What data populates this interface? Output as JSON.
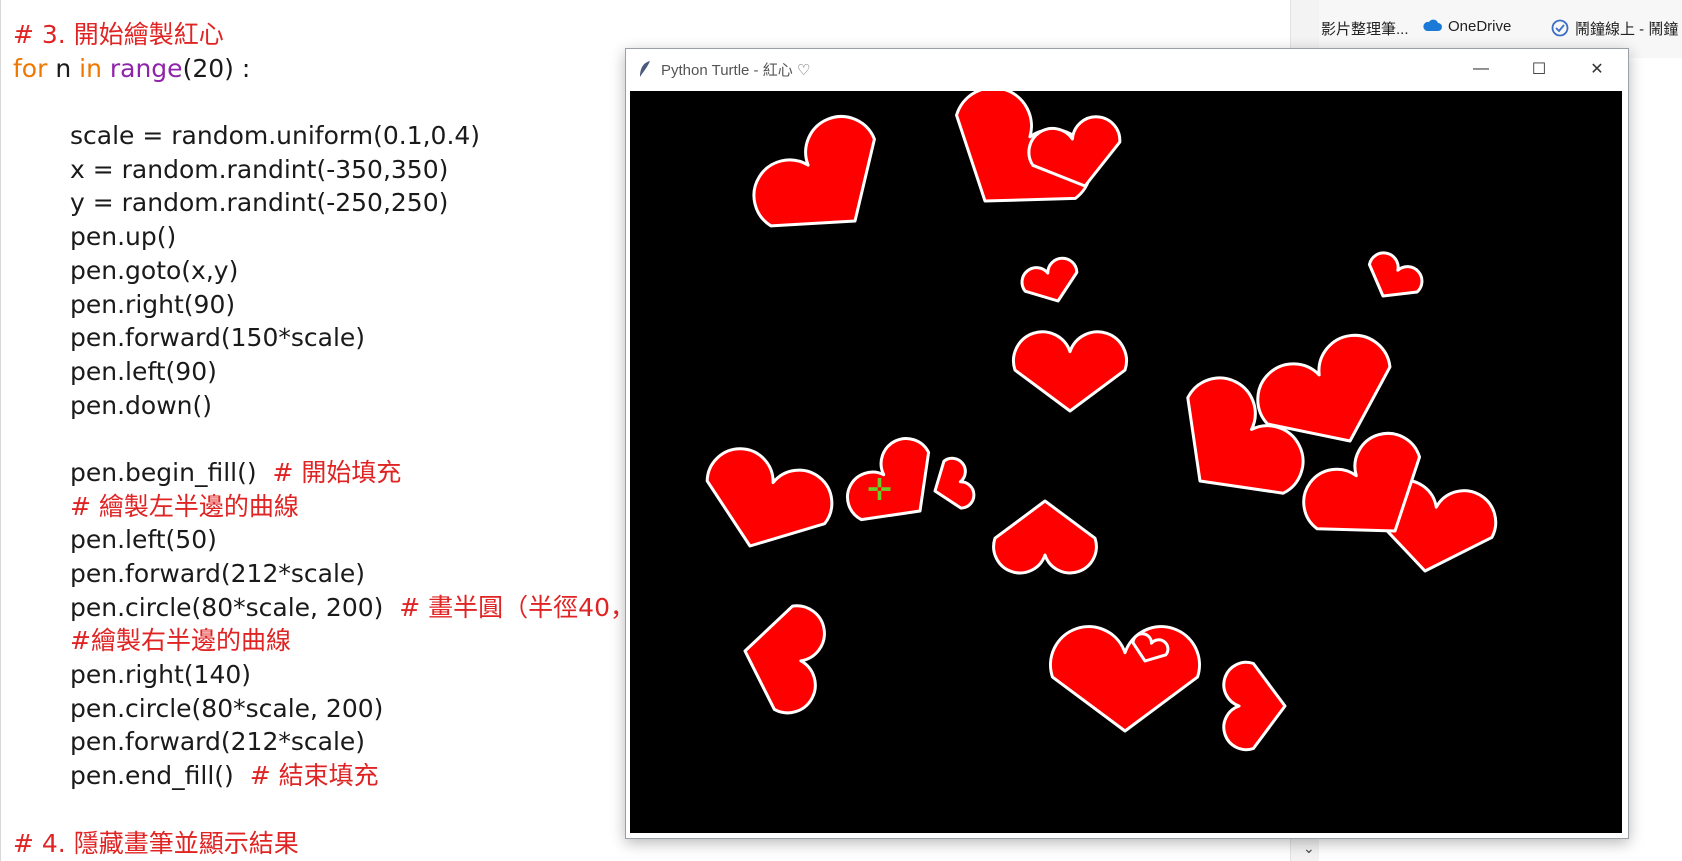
{
  "code": {
    "lines": [
      {
        "type": "comment",
        "text": "# 3. 開始繪製紅心"
      },
      {
        "type": "for",
        "kw1": "for",
        "var": " n ",
        "kw2": "in",
        "fn": " range",
        "rest": "(20) :"
      },
      {
        "type": "blank"
      },
      {
        "type": "code",
        "text": "scale = random.uniform(0.1,0.4)"
      },
      {
        "type": "code",
        "text": "x = random.randint(-350,350)"
      },
      {
        "type": "code",
        "text": "y = random.randint(-250,250)"
      },
      {
        "type": "code",
        "text": "pen.up()"
      },
      {
        "type": "code",
        "text": "pen.goto(x,y)"
      },
      {
        "type": "code",
        "text": "pen.right(90)"
      },
      {
        "type": "code",
        "text": "pen.forward(150*scale)"
      },
      {
        "type": "code",
        "text": "pen.left(90)"
      },
      {
        "type": "code",
        "text": "pen.down()"
      },
      {
        "type": "blank"
      },
      {
        "type": "code_comment",
        "text": "pen.begin_fill()",
        "comment": "  # 開始填充"
      },
      {
        "type": "comment_indent",
        "text": "# 繪製左半邊的曲線"
      },
      {
        "type": "code",
        "text": "pen.left(50)"
      },
      {
        "type": "code",
        "text": "pen.forward(212*scale)"
      },
      {
        "type": "code_comment",
        "text": "pen.circle(80*scale, 200)",
        "comment": "  # 畫半圓（半徑40，"
      },
      {
        "type": "comment_indent",
        "text": "#繪製右半邊的曲線"
      },
      {
        "type": "code",
        "text": "pen.right(140)"
      },
      {
        "type": "code",
        "text": "pen.circle(80*scale, 200)"
      },
      {
        "type": "code",
        "text": "pen.forward(212*scale)"
      },
      {
        "type": "code_comment",
        "text": "pen.end_fill()",
        "comment": "  # 結束填充"
      },
      {
        "type": "blank"
      },
      {
        "type": "comment",
        "text": "# 4. 隱藏畫筆並顯示結果"
      }
    ]
  },
  "bookmarks": [
    {
      "label": "影片整理筆...",
      "icon": "document-icon"
    },
    {
      "label": "OneDrive",
      "icon": "cloud-icon"
    },
    {
      "label": "鬧鐘線上 - 鬧鐘",
      "icon": "checkmark-clock-icon"
    }
  ],
  "turtle_window": {
    "title": "Python Turtle - 紅心 ♡",
    "minimize": "—",
    "maximize": "☐",
    "close": "✕",
    "background_color": "#000000",
    "heart_color": "#ff0000",
    "outline_color": "#ffffff",
    "heart_count": 20
  },
  "colors": {
    "comment": "#e02424",
    "keyword": "#f07800",
    "builtin": "#8e24aa"
  }
}
